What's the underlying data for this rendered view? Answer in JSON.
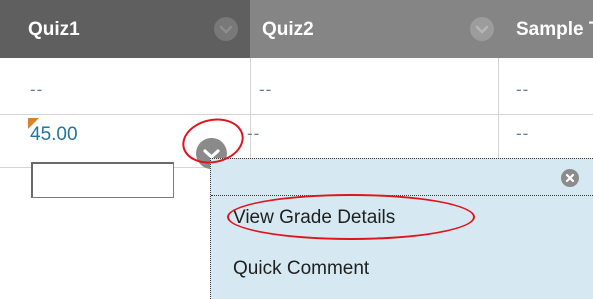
{
  "columns": [
    {
      "label": "Quiz1"
    },
    {
      "label": "Quiz2"
    },
    {
      "label": "Sample T"
    }
  ],
  "rows": [
    {
      "cells": [
        "--",
        "--",
        "--"
      ]
    },
    {
      "cells": [
        "45.00",
        "--",
        "--"
      ]
    }
  ],
  "grade_input": {
    "value": ""
  },
  "context_menu": {
    "items": [
      {
        "label": "View Grade Details"
      },
      {
        "label": "Quick Comment"
      }
    ]
  },
  "colors": {
    "header_active": "#5f5f5f",
    "header": "#858585",
    "grade_link": "#23759f",
    "menu_bg": "#d6e9f2",
    "annotation": "#e0141c",
    "needs_grading_flag": "#d9822b"
  },
  "icons": [
    "chevron-down-icon",
    "close-icon",
    "needs-grading-flag-icon"
  ]
}
